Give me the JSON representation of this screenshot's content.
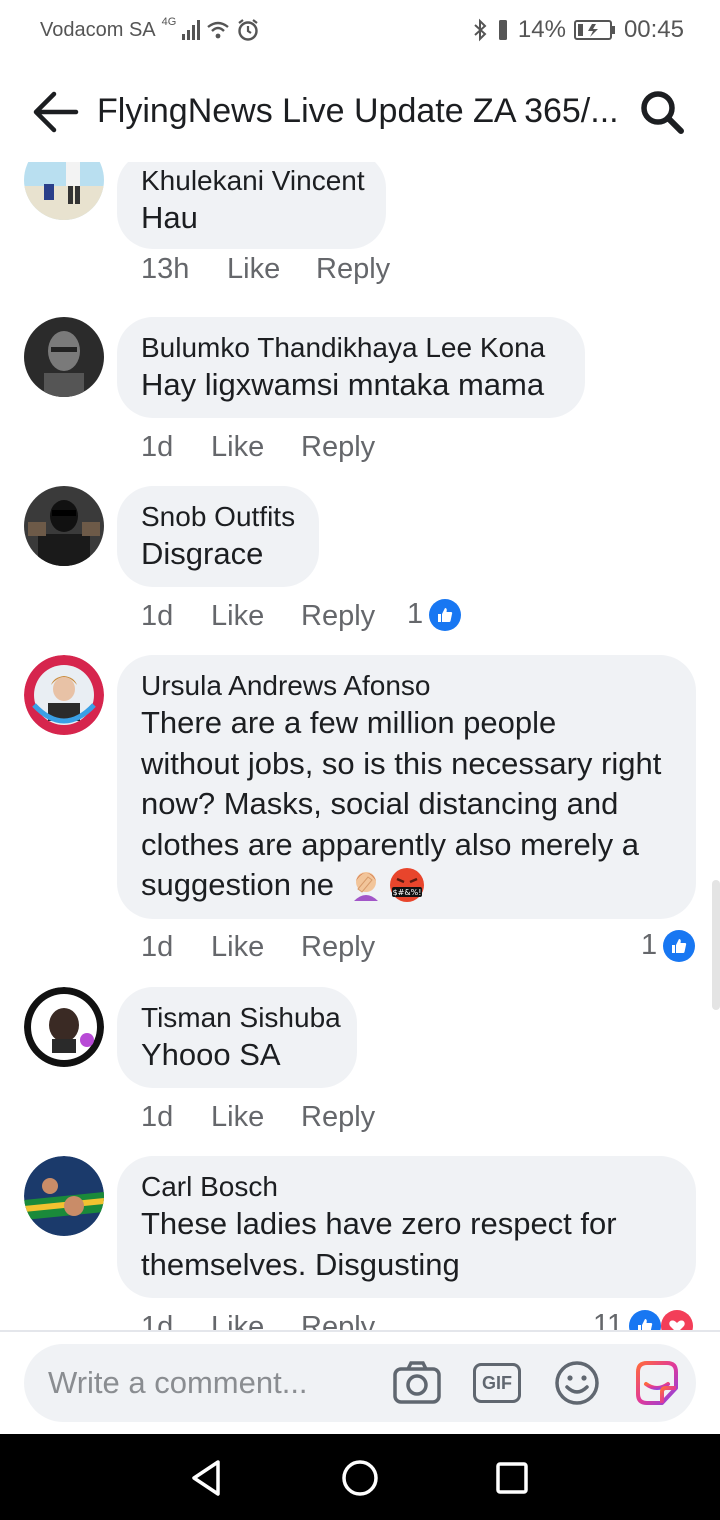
{
  "status_bar": {
    "carrier": "Vodacom SA",
    "network": "4G",
    "battery": "14%",
    "time": "00:45"
  },
  "header": {
    "title": "FlyingNews Live Update ZA 365/..."
  },
  "comments": [
    {
      "author": "Khulekani Vincent",
      "text": "Hau",
      "time": "13h",
      "like": "Like",
      "reply": "Reply",
      "reactions": ""
    },
    {
      "author": "Bulumko Thandikhaya Lee Kona",
      "text": "Hay ligxwamsi mntaka mama",
      "time": "1d",
      "like": "Like",
      "reply": "Reply",
      "reactions": ""
    },
    {
      "author": "Snob Outfits",
      "text": "Disgrace",
      "time": "1d",
      "like": "Like",
      "reply": "Reply",
      "reactions": "1"
    },
    {
      "author": "Ursula Andrews Afonso",
      "text_lines": [
        "There are a few million people",
        "without jobs, so is this necessary right",
        "now? Masks, social distancing and",
        "clothes are apparently also merely a",
        "suggestion ne"
      ],
      "time": "1d",
      "like": "Like",
      "reply": "Reply",
      "reactions": "1"
    },
    {
      "author": "Tisman Sishuba",
      "text": "Yhooo SA",
      "time": "1d",
      "like": "Like",
      "reply": "Reply",
      "reactions": ""
    },
    {
      "author": "Carl Bosch",
      "text_lines": [
        "These ladies have zero respect for",
        "themselves. Disgusting"
      ],
      "time": "1d",
      "like": "Like",
      "reply": "Reply",
      "reactions": "11"
    }
  ],
  "composer": {
    "placeholder": "Write a comment...",
    "gif_label": "GIF"
  },
  "colors": {
    "bubble": "#f0f2f5",
    "like_blue": "#1877f2",
    "love_red": "#f33e58",
    "meta_gray": "#65676b"
  },
  "icons": [
    "back-arrow-icon",
    "search-icon",
    "camera-icon",
    "gif-icon",
    "emoji-icon",
    "sticker-icon",
    "like-reaction-icon",
    "love-reaction-icon"
  ]
}
